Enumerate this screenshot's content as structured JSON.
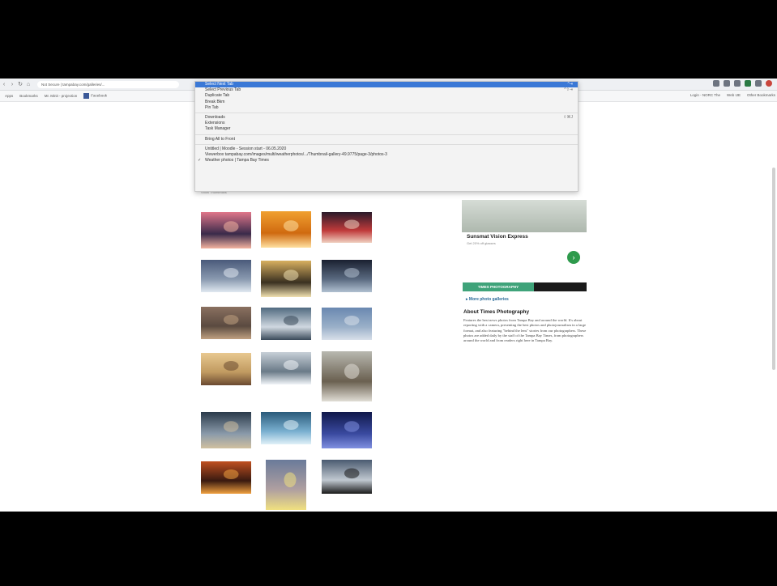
{
  "browser": {
    "url_text": "Not Secure | tampabay.com/galleries/...",
    "bookmarks": [
      "Apps",
      "Bookmarks",
      "Mr. Minit - projection",
      "Facebook"
    ],
    "bookmarks_right": [
      "Login - NORC The",
      "Web IJE",
      "Other Bookmarks"
    ]
  },
  "context_menu": {
    "items": [
      {
        "label": "Select Next Tab",
        "shortcut": "^⇥",
        "selected": true
      },
      {
        "label": "Select Previous Tab",
        "shortcut": "^⇧⇥",
        "selected": false
      },
      {
        "label": "Duplicate Tab",
        "shortcut": "",
        "selected": false
      },
      {
        "label": "Break Bkm",
        "shortcut": "",
        "selected": false
      },
      {
        "label": "Pin Tab",
        "shortcut": "",
        "selected": false
      },
      {
        "label": "Downloads",
        "shortcut": "⇧⌘J",
        "selected": false,
        "sep_before": true
      },
      {
        "label": "Extensions",
        "shortcut": "",
        "selected": false
      },
      {
        "label": "Task Manager",
        "shortcut": "",
        "selected": false
      },
      {
        "label": "Bring All to Front",
        "shortcut": "",
        "selected": false,
        "sep_before": true
      },
      {
        "label": "Untitled | Moodle - Session start - 06.05.2020",
        "shortcut": "",
        "selected": false,
        "sep_before": true
      },
      {
        "label": "Viewerbox tampabay.com/images/multi/weatherphotos/.../Thumbnail-gallery-49.9775/page-3/photos-3",
        "shortcut": "",
        "selected": false
      },
      {
        "label": "Weather photos | Tampa Bay Times",
        "shortcut": "",
        "selected": false,
        "checked": true
      }
    ]
  },
  "gallery": {
    "filter_text": "Show Thumbnails",
    "sort_label": "Most",
    "sort_alt": "Oldest"
  },
  "sidebar": {
    "ad_title": "Sunsmat Vision Express",
    "ad_sub": "Get 20% off glasses",
    "ad_go": "›",
    "tab_active": "TIMES PHOTOGRAPHY",
    "more_link": "More photo galleries",
    "about_title": "About Times Photography",
    "about_text": "Features the best news photos from Tampa Bay and around the world. It's about reporting with a camera, presenting the best photos and photojournalism in a large format, and also featuring \"behind the lens\" stories from our photographers. These photos are added daily by the staff of the Tampa Bay Times, from photographers around the world and from readers right here in Tampa Bay."
  },
  "thumbnails": [
    {
      "id": "sunset-pier",
      "c1": "#e0768a",
      "c2": "#3a2a4a",
      "c3": "#f4b3a0"
    },
    {
      "id": "orange-sun",
      "c1": "#f0a030",
      "c2": "#d06a10",
      "c3": "#ffe0a0"
    },
    {
      "id": "fireworks",
      "c1": "#2a1a2a",
      "c2": "#c03a3a",
      "c3": "#f0d0c0"
    },
    {
      "id": "lightning",
      "c1": "#4a5a7a",
      "c2": "#8a9ab0",
      "c3": "#e0e8f0"
    },
    {
      "id": "beach-dusk",
      "c1": "#d8b060",
      "c2": "#3a3020",
      "c3": "#f0e0b0"
    },
    {
      "id": "dark-sky",
      "c1": "#1a2030",
      "c2": "#5a6a80",
      "c3": "#b0c0d0"
    },
    {
      "id": "haze",
      "c1": "#8a7060",
      "c2": "#5a4a40",
      "c3": "#c0a080"
    },
    {
      "id": "bird-splash",
      "c1": "#506a80",
      "c2": "#d0d8e0",
      "c3": "#3a4a5a"
    },
    {
      "id": "rain-window",
      "c1": "#6a88b0",
      "c2": "#9ab0c8",
      "c3": "#d8e0ea"
    },
    {
      "id": "reeds",
      "c1": "#e8c890",
      "c2": "#c09a60",
      "c3": "#6a4a30"
    },
    {
      "id": "frost-trees",
      "c1": "#c8d0d8",
      "c2": "#6a7a88",
      "c3": "#f0f4f8"
    },
    {
      "id": "fog",
      "c1": "#b8b8b0",
      "c2": "#6a6050",
      "c3": "#e0ddd5"
    },
    {
      "id": "city-night",
      "c1": "#2a3a4a",
      "c2": "#8a9aaa",
      "c3": "#d0c0a0"
    },
    {
      "id": "wave",
      "c1": "#2a5a7a",
      "c2": "#7ab0d0",
      "c3": "#e0f0f8"
    },
    {
      "id": "blue-night",
      "c1": "#10184a",
      "c2": "#3a4aa0",
      "c3": "#8090e0"
    },
    {
      "id": "fire-sky",
      "c1": "#c05020",
      "c2": "#3a1a10",
      "c3": "#f0a040"
    },
    {
      "id": "rainbow",
      "c1": "#6a7a9a",
      "c2": "#b0a0a0",
      "c3": "#f0e080"
    },
    {
      "id": "vortex",
      "c1": "#4a5a70",
      "c2": "#c0c8d0",
      "c3": "#1a1a1a"
    }
  ]
}
